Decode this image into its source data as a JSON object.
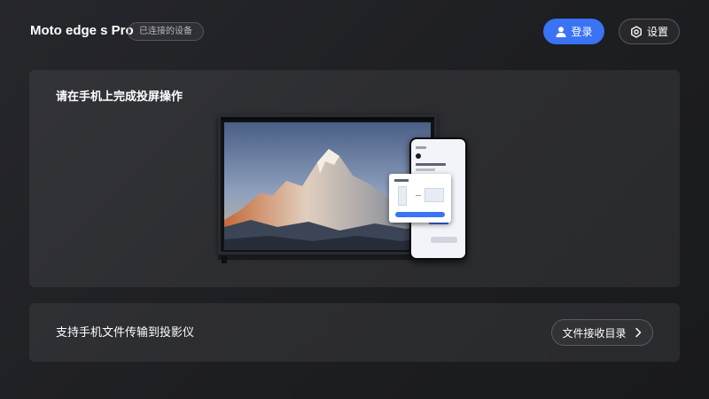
{
  "header": {
    "device_name": "Moto edge s Pro",
    "connected_label": "已连接的设备",
    "login_label": "登录",
    "settings_label": "设置"
  },
  "cast_card": {
    "title": "请在手机上完成投屏操作"
  },
  "file_card": {
    "text": "支持手机文件传输到投影仪",
    "button_label": "文件接收目录"
  },
  "icons": {
    "login": "user-icon",
    "settings": "gear-icon",
    "file_button": "chevron-right-icon"
  },
  "colors": {
    "accent": "#3a73f4",
    "background": "#1d1e22",
    "card": "#2a2b30"
  }
}
